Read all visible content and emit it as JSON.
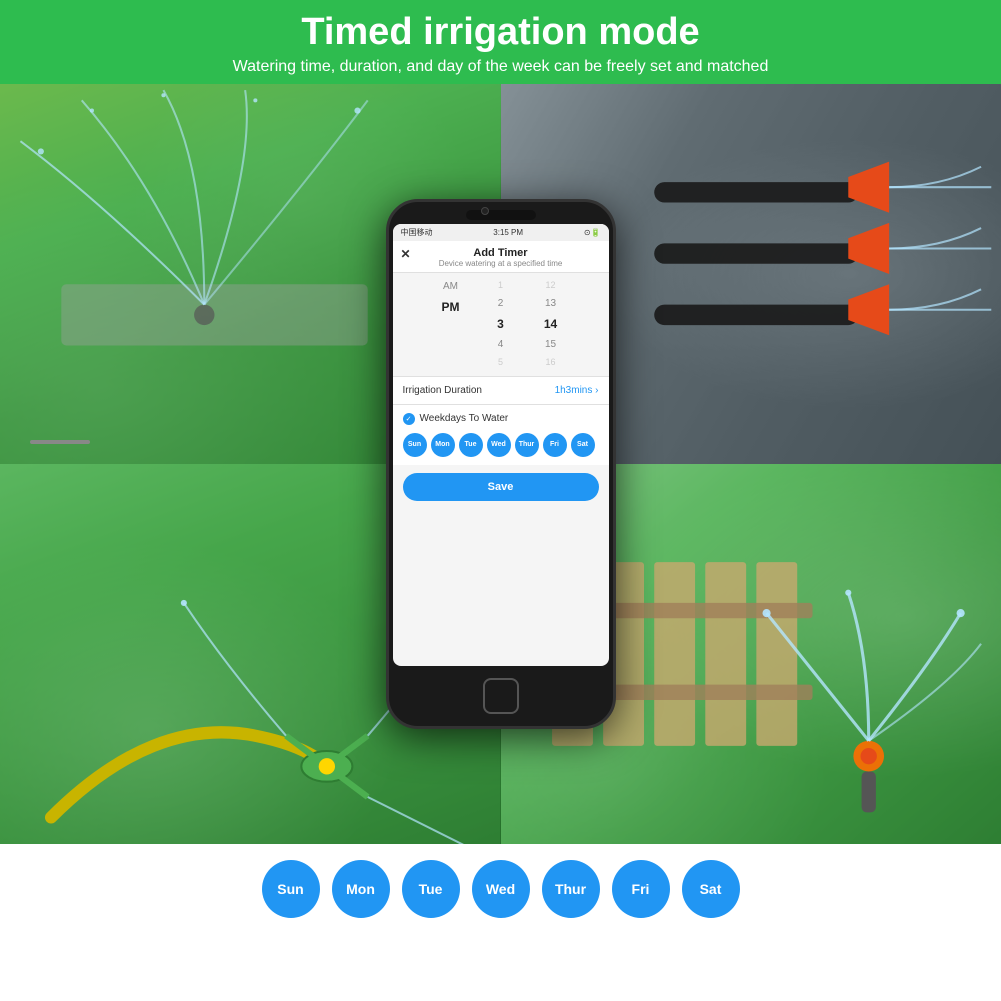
{
  "header": {
    "title": "Timed irrigation mode",
    "subtitle": "Watering time, duration, and day of the week can be freely set and matched",
    "bg_color": "#2ebc4f"
  },
  "phone": {
    "status_bar": {
      "carrier": "中国移动",
      "wifi": "wifi",
      "time": "3:15 PM",
      "icons": "⊙ 🔔"
    },
    "screen": {
      "close_icon": "✕",
      "title": "Add Timer",
      "subtitle": "Device watering at a specified time",
      "time_picker": {
        "ampm_values": [
          "",
          "AM",
          "PM",
          "",
          ""
        ],
        "hour_values": [
          "1",
          "2",
          "3",
          "4",
          "5"
        ],
        "minute_values": [
          "12",
          "13",
          "14",
          "15",
          "16"
        ],
        "selected_ampm": "PM",
        "selected_hour": "3",
        "selected_minute": "14"
      },
      "duration": {
        "label": "Irrigation Duration",
        "value": "1h3mins",
        "chevron": ">"
      },
      "weekdays": {
        "checked": true,
        "title": "Weekdays To Water",
        "days": [
          "Sun",
          "Mon",
          "Tue",
          "Wed",
          "Thur",
          "Fri",
          "Sat"
        ]
      },
      "save_button": "Save"
    }
  },
  "bottom_days": {
    "days": [
      "Sun",
      "Mon",
      "Tue",
      "Wed",
      "Thur",
      "Fri",
      "Sat"
    ]
  },
  "colors": {
    "green": "#2ebc4f",
    "blue": "#2196F3",
    "dark": "#1a1a1a"
  }
}
